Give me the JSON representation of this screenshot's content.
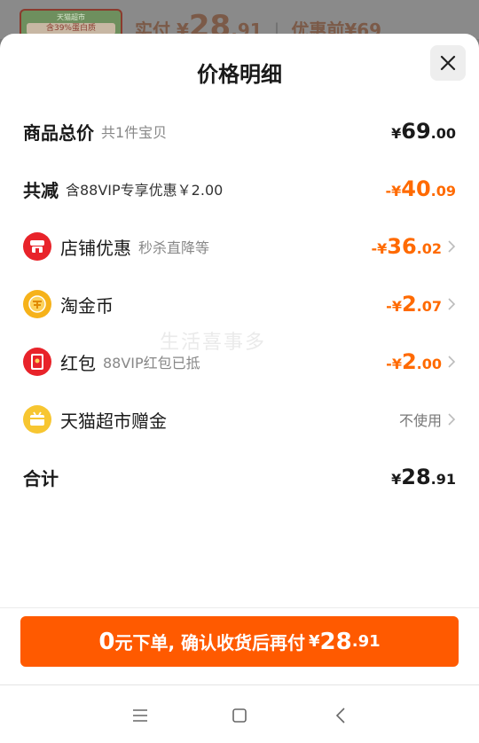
{
  "backdrop": {
    "thumb_line1": "天猫超市",
    "thumb_line2": "含39%蛋白质",
    "paid_label": "实付",
    "paid_currency": "¥",
    "paid_int": "28",
    "paid_dec": ".91",
    "before_label": "优惠前",
    "before_currency": "¥",
    "before_value": "69"
  },
  "sheet": {
    "title": "价格明细",
    "close_icon": "close-icon",
    "watermark": "生活喜事多"
  },
  "rows": {
    "total_price": {
      "label": "商品总价",
      "sub": "共1件宝贝",
      "currency": "¥",
      "int": "69",
      "dec": ".00"
    },
    "total_reduce": {
      "label": "共减",
      "sub": "含88VIP专享优惠￥2.00",
      "currency": "-¥",
      "int": "40",
      "dec": ".09"
    },
    "shop_discount": {
      "label": "店铺优惠",
      "sub": "秒杀直降等",
      "currency": "-¥",
      "int": "36",
      "dec": ".02",
      "icon": "shop-icon"
    },
    "taojinbi": {
      "label": "淘金币",
      "currency": "-¥",
      "int": "2",
      "dec": ".07",
      "icon": "coin-icon"
    },
    "hongbao": {
      "label": "红包",
      "sub": "88VIP红包已抵",
      "currency": "-¥",
      "int": "2",
      "dec": ".00",
      "icon": "red-packet-icon"
    },
    "tmall_gift": {
      "label": "天猫超市赠金",
      "value": "不使用",
      "icon": "gift-money-icon"
    },
    "sum": {
      "label": "合计",
      "currency": "¥",
      "int": "28",
      "dec": ".91"
    }
  },
  "cta": {
    "zero": "0",
    "text": "元下单, 确认收货后再付",
    "currency": "¥",
    "int": "28",
    "dec": ".91"
  },
  "navbar": {
    "menu_icon": "menu-icon",
    "home_icon": "home-square-icon",
    "back_icon": "back-chevron-icon"
  },
  "colors": {
    "accent_orange": "#ff6a00",
    "cta_orange": "#ff5a00",
    "shop_red": "#e8232a",
    "coin_yellow": "#f6b21a",
    "gift_yellow": "#f7c631"
  }
}
